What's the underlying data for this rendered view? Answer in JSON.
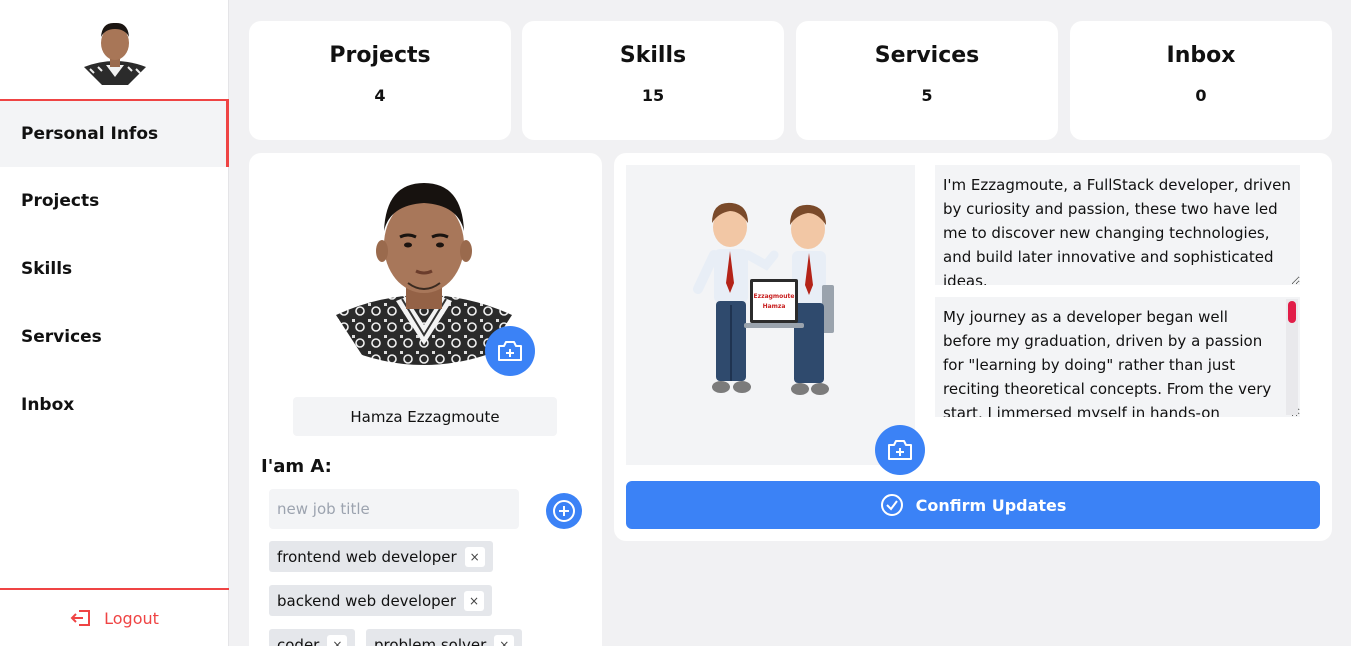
{
  "sidebar": {
    "items": [
      {
        "label": "Personal Infos",
        "active": true
      },
      {
        "label": "Projects"
      },
      {
        "label": "Skills"
      },
      {
        "label": "Services"
      },
      {
        "label": "Inbox"
      }
    ],
    "logout_label": "Logout"
  },
  "stats": [
    {
      "title": "Projects",
      "value": "4"
    },
    {
      "title": "Skills",
      "value": "15"
    },
    {
      "title": "Services",
      "value": "5"
    },
    {
      "title": "Inbox",
      "value": "0"
    }
  ],
  "profile": {
    "name": "Hamza Ezzagmoute",
    "iam_label": "I'am A:",
    "job_placeholder": "new job title",
    "job_titles": [
      "frontend web developer",
      "backend web developer",
      "coder",
      "problem solver"
    ],
    "remove_symbol": "×"
  },
  "about": {
    "laptop_text": [
      "Ezzagmoute",
      "Hamza"
    ],
    "intro": "I'm Ezzagmoute, a FullStack developer, driven by curiosity and passion, these two have led me to discover new changing technologies, and build later innovative and sophisticated ideas.",
    "journey": "My journey as a developer began well before my graduation, driven by a passion for \"learning by doing\" rather than just reciting theoretical concepts. From the very start, I immersed myself in hands-on projects, diving",
    "confirm_label": "Confirm Updates"
  },
  "colors": {
    "accent": "#3b82f6",
    "danger": "#ef4444",
    "background": "#f1f1f3"
  }
}
